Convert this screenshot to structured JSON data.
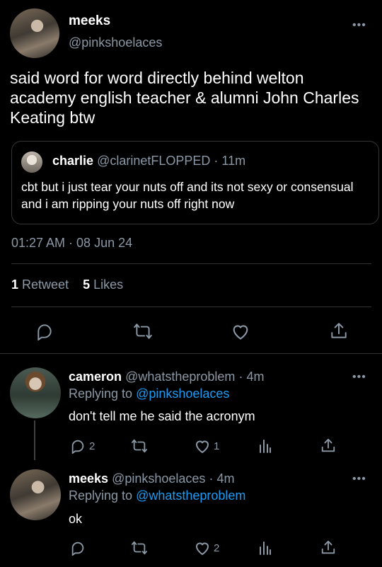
{
  "main_tweet": {
    "display_name": "meeks",
    "handle": "@pinkshoelaces",
    "text": "said word for word directly behind welton academy english teacher & alumni John Charles Keating btw",
    "quoted": {
      "display_name": "charlie",
      "handle": "@clarinetFLOPPED",
      "time": "11m",
      "text": "cbt but i just tear your nuts off and its not sexy or consensual and i am ripping your nuts off right now"
    },
    "timestamp": "01:27 AM · 08 Jun 24",
    "retweet_count": "1",
    "retweet_label": "Retweet",
    "like_count": "5",
    "like_label": "Likes"
  },
  "replies": [
    {
      "display_name": "cameron",
      "handle": "@whatstheproblem",
      "time": "4m",
      "replying_prefix": "Replying to",
      "replying_to": "@pinkshoelaces",
      "text": "don't tell me he said the acronym",
      "reply_count": "2",
      "retweet_count": "",
      "like_count": "1"
    },
    {
      "display_name": "meeks",
      "handle": "@pinkshoelaces",
      "time": "4m",
      "replying_prefix": "Replying to",
      "replying_to": "@whatstheproblem",
      "text": "ok",
      "reply_count": "",
      "retweet_count": "",
      "like_count": "2"
    }
  ],
  "separator": "·",
  "more_menu": "•••",
  "icons": [
    "reply-icon",
    "retweet-icon",
    "like-icon",
    "share-icon",
    "analytics-icon",
    "more-icon"
  ],
  "colors": {
    "background": "#000000",
    "muted": "#8b98a5",
    "link": "#1d9bf0",
    "divider": "#2f3336"
  }
}
